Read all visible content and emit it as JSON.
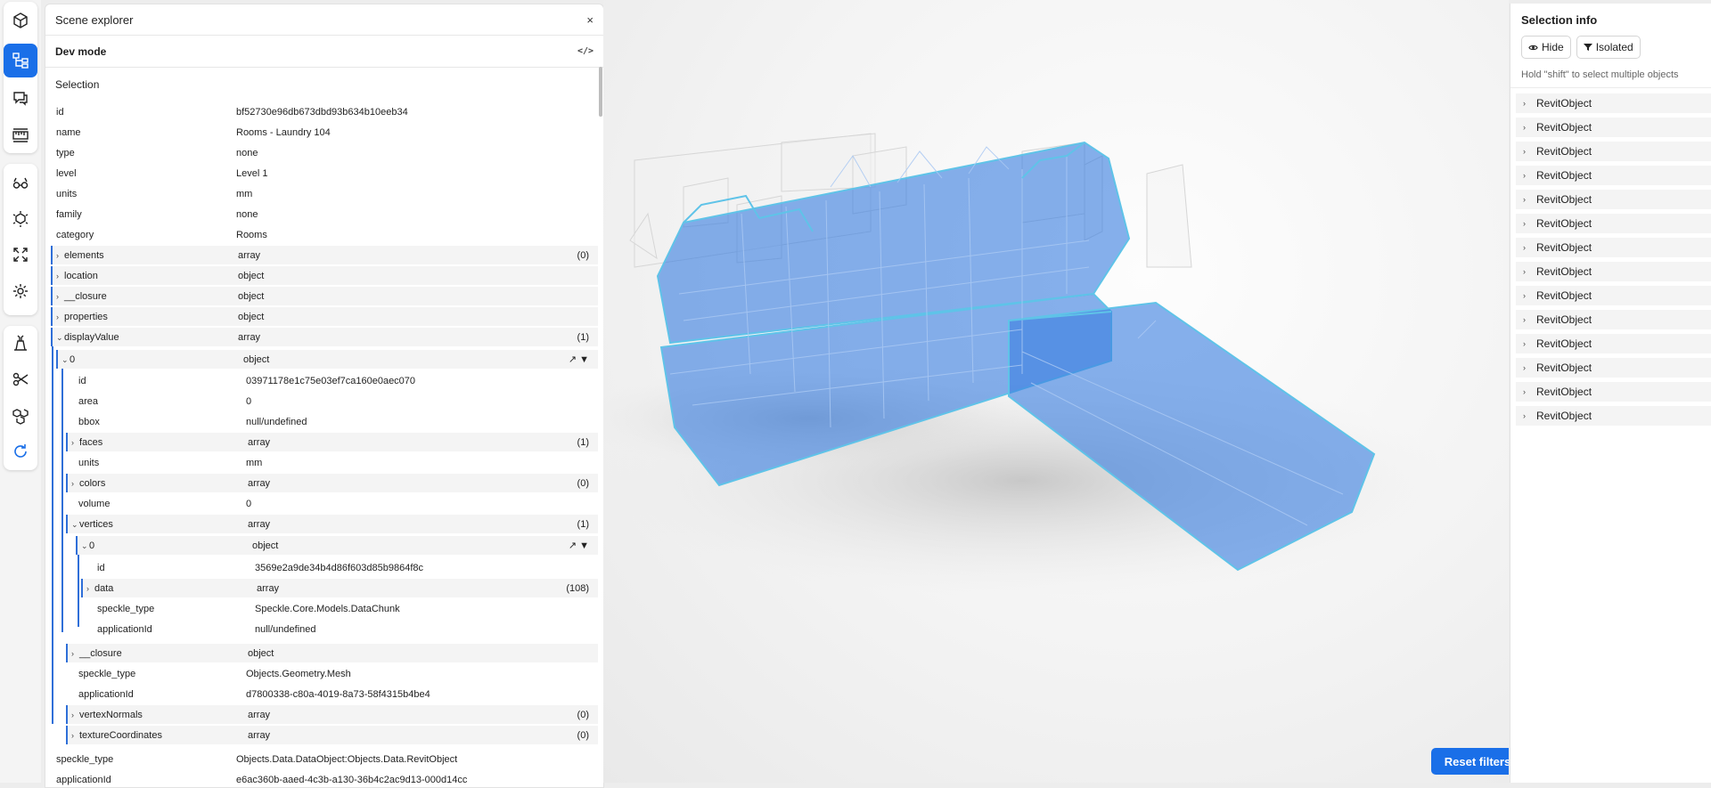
{
  "toolbar": {
    "tools": [
      {
        "name": "model-icon",
        "group": 0
      },
      {
        "name": "scene-explorer-icon",
        "group": 0,
        "active": true
      },
      {
        "name": "discussions-icon",
        "group": 0
      },
      {
        "name": "measure-icon",
        "group": 0
      },
      {
        "name": "views-icon",
        "group": 1
      },
      {
        "name": "explode-icon",
        "group": 1
      },
      {
        "name": "zoom-extents-icon",
        "group": 1
      },
      {
        "name": "sun-icon",
        "group": 1
      },
      {
        "name": "section-box-icon",
        "group": 2
      },
      {
        "name": "cut-icon",
        "group": 2
      },
      {
        "name": "3d-objects-icon",
        "group": 2
      },
      {
        "name": "sync-icon",
        "group": 2
      }
    ]
  },
  "explorer": {
    "title": "Scene explorer",
    "close": "×",
    "dev_mode": "Dev mode",
    "code_icon": "</>",
    "selection_title": "Selection",
    "rows": [
      {
        "k": "id",
        "v": "bf52730e96db673dbd93b634b10eeb34"
      },
      {
        "k": "name",
        "v": "Rooms - Laundry 104"
      },
      {
        "k": "type",
        "v": "none"
      },
      {
        "k": "level",
        "v": "Level 1"
      },
      {
        "k": "units",
        "v": "mm"
      },
      {
        "k": "family",
        "v": "none"
      },
      {
        "k": "category",
        "v": "Rooms"
      },
      {
        "k": "elements",
        "v": "array",
        "c": "(0)",
        "chev": ">"
      },
      {
        "k": "location",
        "v": "object",
        "chev": ">"
      },
      {
        "k": "__closure",
        "v": "object",
        "chev": ">"
      },
      {
        "k": "properties",
        "v": "object",
        "chev": ">"
      },
      {
        "k": "displayValue",
        "v": "array",
        "c": "(1)",
        "chev": "v"
      },
      {
        "k": "0",
        "v": "object",
        "chev": "v",
        "icons": "↗ ▼"
      },
      {
        "k": "id",
        "v": "03971178e1c75e03ef7ca160e0aec070"
      },
      {
        "k": "area",
        "v": "0"
      },
      {
        "k": "bbox",
        "v": "null/undefined"
      },
      {
        "k": "faces",
        "v": "array",
        "c": "(1)",
        "chev": ">"
      },
      {
        "k": "units",
        "v": "mm"
      },
      {
        "k": "colors",
        "v": "array",
        "c": "(0)",
        "chev": ">"
      },
      {
        "k": "volume",
        "v": "0"
      },
      {
        "k": "vertices",
        "v": "array",
        "c": "(1)",
        "chev": "v"
      },
      {
        "k": "0",
        "v": "object",
        "chev": "v",
        "icons": "↗ ▼"
      },
      {
        "k": "id",
        "v": "3569e2a9de34b4d86f603d85b9864f8c"
      },
      {
        "k": "data",
        "v": "array",
        "c": "(108)",
        "chev": ">"
      },
      {
        "k": "speckle_type",
        "v": "Speckle.Core.Models.DataChunk"
      },
      {
        "k": "applicationId",
        "v": "null/undefined"
      },
      {
        "k": "__closure",
        "v": "object",
        "chev": ">"
      },
      {
        "k": "speckle_type",
        "v": "Objects.Geometry.Mesh"
      },
      {
        "k": "applicationId",
        "v": "d7800338-c80a-4019-8a73-58f4315b4be4"
      },
      {
        "k": "vertexNormals",
        "v": "array",
        "c": "(0)",
        "chev": ">"
      },
      {
        "k": "textureCoordinates",
        "v": "array",
        "c": "(0)",
        "chev": ">"
      },
      {
        "k": "speckle_type",
        "v": "Objects.Data.DataObject:Objects.Data.RevitObject"
      },
      {
        "k": "applicationId",
        "v": "e6ac360b-aaed-4c3b-a130-36b4c2ac9d13-000d14cc"
      }
    ]
  },
  "viewer": {
    "reset_label": "Reset filters",
    "model_color": "#4a8ae8"
  },
  "selection_info": {
    "title": "Selection info",
    "hide_label": "Hide",
    "isolated_label": "Isolated",
    "hint": "Hold \"shift\" to select multiple objects",
    "items": [
      "RevitObject",
      "RevitObject",
      "RevitObject",
      "RevitObject",
      "RevitObject",
      "RevitObject",
      "RevitObject",
      "RevitObject",
      "RevitObject",
      "RevitObject",
      "RevitObject",
      "RevitObject",
      "RevitObject",
      "RevitObject"
    ]
  }
}
